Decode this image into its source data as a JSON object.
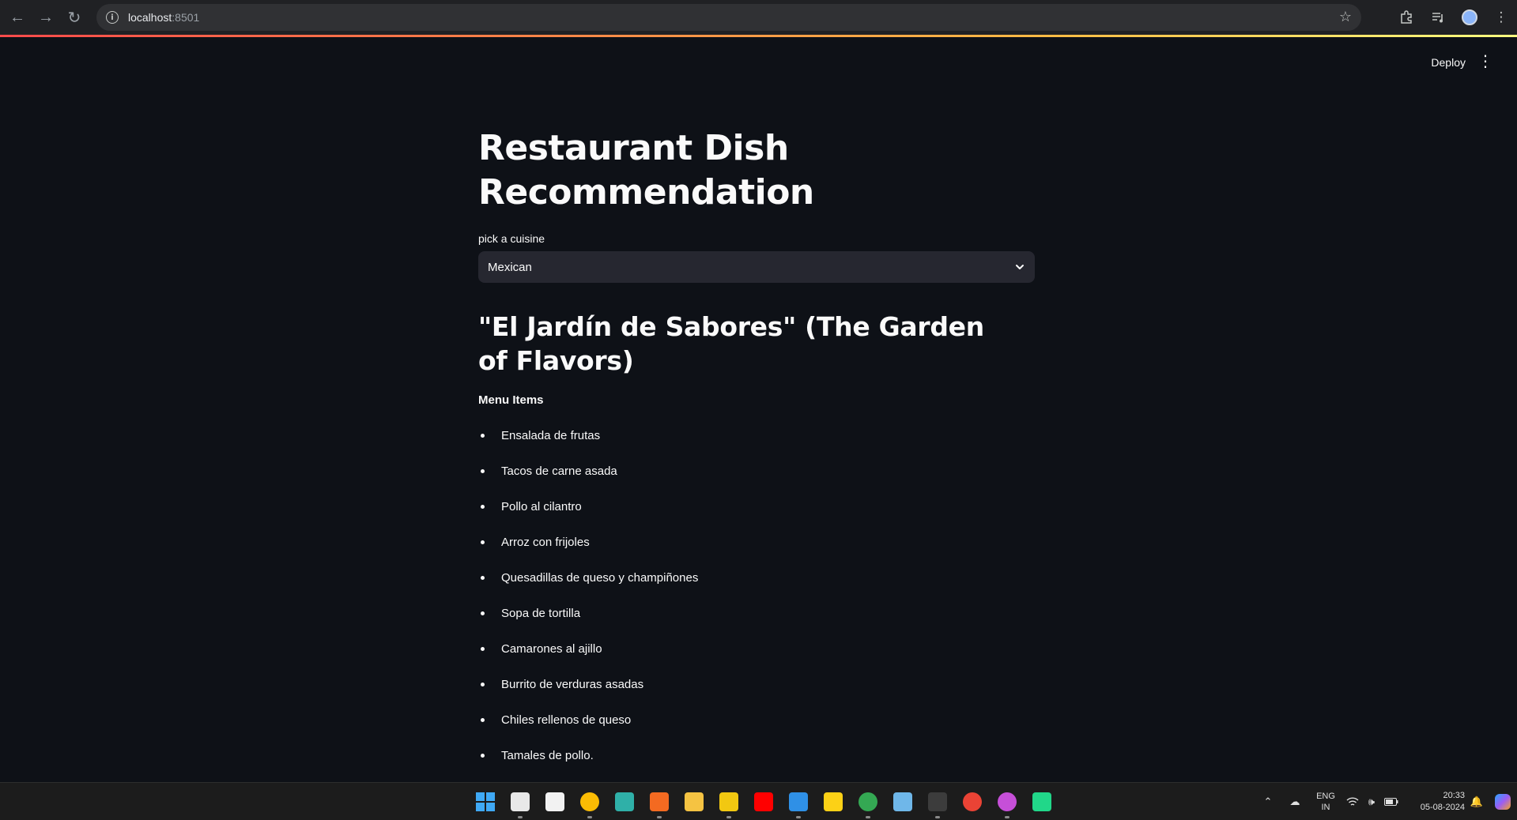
{
  "browser": {
    "url_host": "localhost",
    "url_port": ":8501",
    "nav_icons": [
      "back-arrow-icon",
      "forward-arrow-icon",
      "reload-icon"
    ],
    "right_icons": [
      "bookmark-star-icon",
      "extensions-puzzle-icon",
      "media-queue-icon",
      "profile-avatar",
      "menu-kebab-icon"
    ]
  },
  "toolbar": {
    "deploy_label": "Deploy"
  },
  "main": {
    "title": "Restaurant Dish Recommendation",
    "select_label": "pick a cuisine",
    "select_value": "Mexican",
    "restaurant_name": "\"El Jardín de Sabores\" (The Garden of Flavors)",
    "menu_heading": "Menu Items",
    "menu_items": [
      "Ensalada de frutas",
      "Tacos de carne asada",
      "Pollo al cilantro",
      "Arroz con frijoles",
      "Quesadillas de queso y champiñones",
      "Sopa de tortilla",
      "Camarones al ajillo",
      "Burrito de verduras asadas",
      "Chiles rellenos de queso",
      "Tamales de pollo."
    ]
  },
  "taskbar": {
    "apps": [
      {
        "name": "start-windows-icon",
        "color": "#3fa9f5"
      },
      {
        "name": "snipping-tool-icon",
        "color": "#e8e8e8"
      },
      {
        "name": "microsoft-store-icon",
        "color": "#f2f2f2"
      },
      {
        "name": "chrome-icon",
        "color": "#fbbc04"
      },
      {
        "name": "edge-icon",
        "color": "#2fb0a8"
      },
      {
        "name": "app-orange-icon",
        "color": "#f36a21"
      },
      {
        "name": "file-explorer-icon",
        "color": "#f5c342"
      },
      {
        "name": "power-bi-icon",
        "color": "#f2c811"
      },
      {
        "name": "youtube-music-icon",
        "color": "#ff0000"
      },
      {
        "name": "vscode-icon",
        "color": "#2f90e6"
      },
      {
        "name": "sticky-notes-icon",
        "color": "#fcd116"
      },
      {
        "name": "chrome-profile-icon",
        "color": "#34a853"
      },
      {
        "name": "remote-desktop-icon",
        "color": "#6fb7e9"
      },
      {
        "name": "terminal-icon",
        "color": "#3c3c3c"
      },
      {
        "name": "chrome-profile-2-icon",
        "color": "#ea4335"
      },
      {
        "name": "chrome-profile-3-icon",
        "color": "#c64fd8"
      },
      {
        "name": "pycharm-icon",
        "color": "#21d789"
      }
    ],
    "tray": {
      "lang_line1": "ENG",
      "lang_line2": "IN",
      "time": "20:33",
      "date": "05-08-2024"
    }
  },
  "colors": {
    "background": "#0e1117",
    "select_bg": "#262730",
    "text": "#fafafa",
    "accent_red": "#ff4b4b"
  }
}
